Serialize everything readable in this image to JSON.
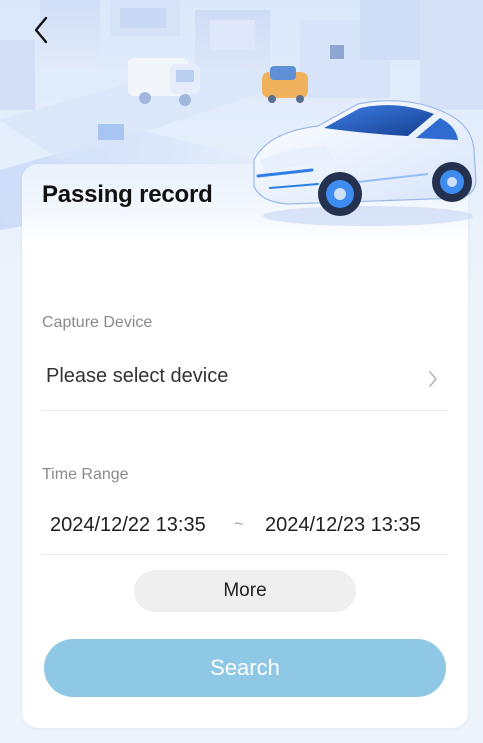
{
  "header": {
    "back_icon": "chevron-left-icon",
    "title": "Passing record"
  },
  "form": {
    "capture_device": {
      "label": "Capture Device",
      "value": "Please select device",
      "chevron_icon": "chevron-right-icon"
    },
    "time_range": {
      "label": "Time Range",
      "start": "2024/12/22 13:35",
      "separator": "~",
      "end": "2024/12/23 13:35"
    },
    "more_label": "More",
    "search_label": "Search"
  },
  "colors": {
    "search_button": "#8ec8e5",
    "more_button": "#efefef",
    "background": "#eef4fb",
    "car_accent": "#2f7ee8"
  }
}
